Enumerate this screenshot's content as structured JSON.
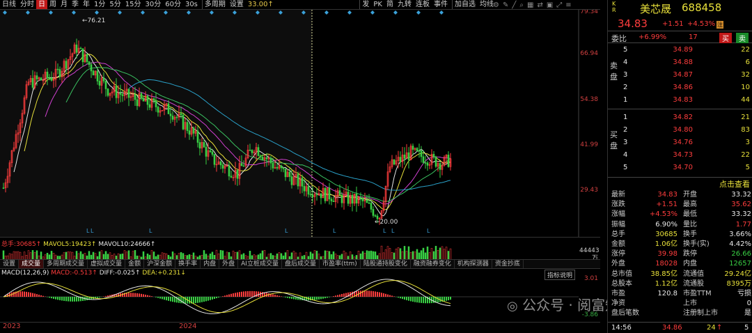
{
  "toolbar": {
    "periods": [
      "日线",
      "分时",
      "日",
      "周",
      "月",
      "季",
      "年",
      "1分",
      "5分",
      "15分",
      "30分",
      "60分",
      "30s"
    ],
    "active_period": "日",
    "multi_period": "多周期",
    "settings": "设置",
    "price_tag": "33.00↑",
    "right_tools": [
      "发",
      "PK",
      "简",
      "九转",
      "连板",
      "事件",
      "加自选",
      "均线"
    ]
  },
  "price_axis": [
    "79.34",
    "66.94",
    "54.38",
    "41.99",
    "29.43"
  ],
  "high_label": "76.21",
  "low_label": "20.00",
  "volume": {
    "total_label": "总手:",
    "total": "30685↑",
    "mavol5_label": "MAVOL5:",
    "mavol5": "19423↑",
    "mavol10_label": "MAVOL10:",
    "mavol10": "24666↑",
    "axis": [
      "44443",
      "万"
    ]
  },
  "subtabs": [
    "设置",
    "成交量",
    "多周期成交量",
    "虚拟成交量",
    "金额",
    "沪深金额",
    "换手率",
    "内盘",
    "外盘",
    "AI立桩成交量",
    "盘后成交量",
    "市盈率(ttm)",
    "陆股通持股变化",
    "融资融券变化",
    "机构探测器",
    "资金抄底"
  ],
  "active_subtab": "成交量",
  "macd": {
    "title": "MACD(12,26,9)",
    "macd_label": "MACD:",
    "macd": "-0.513↑",
    "diff_label": "DIFF:",
    "diff": "-0.025↑",
    "dea_label": "DEA:",
    "dea": "+0.231↓",
    "help": "指标说明",
    "axis_top": "3.01",
    "axis_bottom": "-3.86"
  },
  "years": [
    "2023",
    "2024"
  ],
  "watermark": "公众号 · 阅富知声",
  "quote": {
    "market_tag": [
      "K",
      "R"
    ],
    "name": "美芯晟",
    "code": "688458",
    "price": "34.83",
    "change": "+1.51",
    "change_pct": "+4.53%",
    "badge": "注",
    "weibi_label": "委比",
    "weibi": "+6.99%",
    "weicha": "17",
    "buy_btn": "买",
    "sell_btn": "卖",
    "sell_side_label": [
      "卖",
      "盘"
    ],
    "buy_side_label": [
      "买",
      "盘"
    ],
    "asks": [
      {
        "lv": "5",
        "p": "34.89",
        "v": "22"
      },
      {
        "lv": "4",
        "p": "34.88",
        "v": "6"
      },
      {
        "lv": "3",
        "p": "34.87",
        "v": "32"
      },
      {
        "lv": "2",
        "p": "34.86",
        "v": "10"
      },
      {
        "lv": "1",
        "p": "34.83",
        "v": "44"
      }
    ],
    "bids": [
      {
        "lv": "1",
        "p": "34.82",
        "v": "21"
      },
      {
        "lv": "2",
        "p": "34.80",
        "v": "83"
      },
      {
        "lv": "3",
        "p": "34.76",
        "v": "3"
      },
      {
        "lv": "4",
        "p": "34.73",
        "v": "22"
      },
      {
        "lv": "5",
        "p": "34.70",
        "v": "5"
      }
    ],
    "check_label": "点击查看",
    "stats": [
      {
        "k1": "最新",
        "v1": "34.83",
        "c1": "red",
        "k2": "开盘",
        "v2": "33.32",
        "c2": "wht"
      },
      {
        "k1": "涨跌",
        "v1": "+1.51",
        "c1": "red",
        "k2": "最高",
        "v2": "35.62",
        "c2": "red"
      },
      {
        "k1": "涨幅",
        "v1": "+4.53%",
        "c1": "red",
        "k2": "最低",
        "v2": "33.32",
        "c2": "wht"
      },
      {
        "k1": "振幅",
        "v1": "6.90%",
        "c1": "wht",
        "k2": "量比",
        "v2": "1.77",
        "c2": "red"
      },
      {
        "k1": "总手",
        "v1": "30685",
        "c1": "yel",
        "k2": "换手",
        "v2": "3.66%",
        "c2": "wht"
      },
      {
        "k1": "金额",
        "v1": "1.06亿",
        "c1": "yel",
        "k2": "换手(实)",
        "v2": "4.42%",
        "c2": "wht"
      },
      {
        "k1": "涨停",
        "v1": "39.98",
        "c1": "red",
        "k2": "跌停",
        "v2": "26.66",
        "c2": "grn"
      },
      {
        "k1": "外盘",
        "v1": "18028",
        "c1": "red",
        "k2": "内盘",
        "v2": "12657",
        "c2": "grn"
      },
      {
        "k1": "总市值",
        "v1": "38.85亿",
        "c1": "yel",
        "k2": "流通值",
        "v2": "29.24亿",
        "c2": "yel"
      },
      {
        "k1": "总股本",
        "v1": "1.12亿",
        "c1": "yel",
        "k2": "流通股",
        "v2": "8395万",
        "c2": "yel"
      },
      {
        "k1": "市盈",
        "v1": "120.8",
        "c1": "wht",
        "k2": "市盈TTM",
        "v2": "亏损",
        "c2": "wht"
      },
      {
        "k1": "净资",
        "v1": "",
        "c1": "wht",
        "k2": "上市",
        "v2": "0",
        "c2": "wht"
      },
      {
        "k1": "盘后笔数",
        "v1": "",
        "c1": "wht",
        "k2": "注册制上市",
        "v2": "是",
        "c2": "wht"
      }
    ],
    "tick": {
      "time": "14:56",
      "price": "34.86",
      "vol": "24",
      "arrow": "↑",
      "count": "5"
    }
  },
  "colors": {
    "up": "#ff3d3d",
    "down": "#39d044",
    "ma5": "#e8e8e8",
    "ma10": "#e8e03a",
    "ma20": "#d040d0",
    "ma60": "#3ac060",
    "ma120": "#2aa0c8"
  }
}
